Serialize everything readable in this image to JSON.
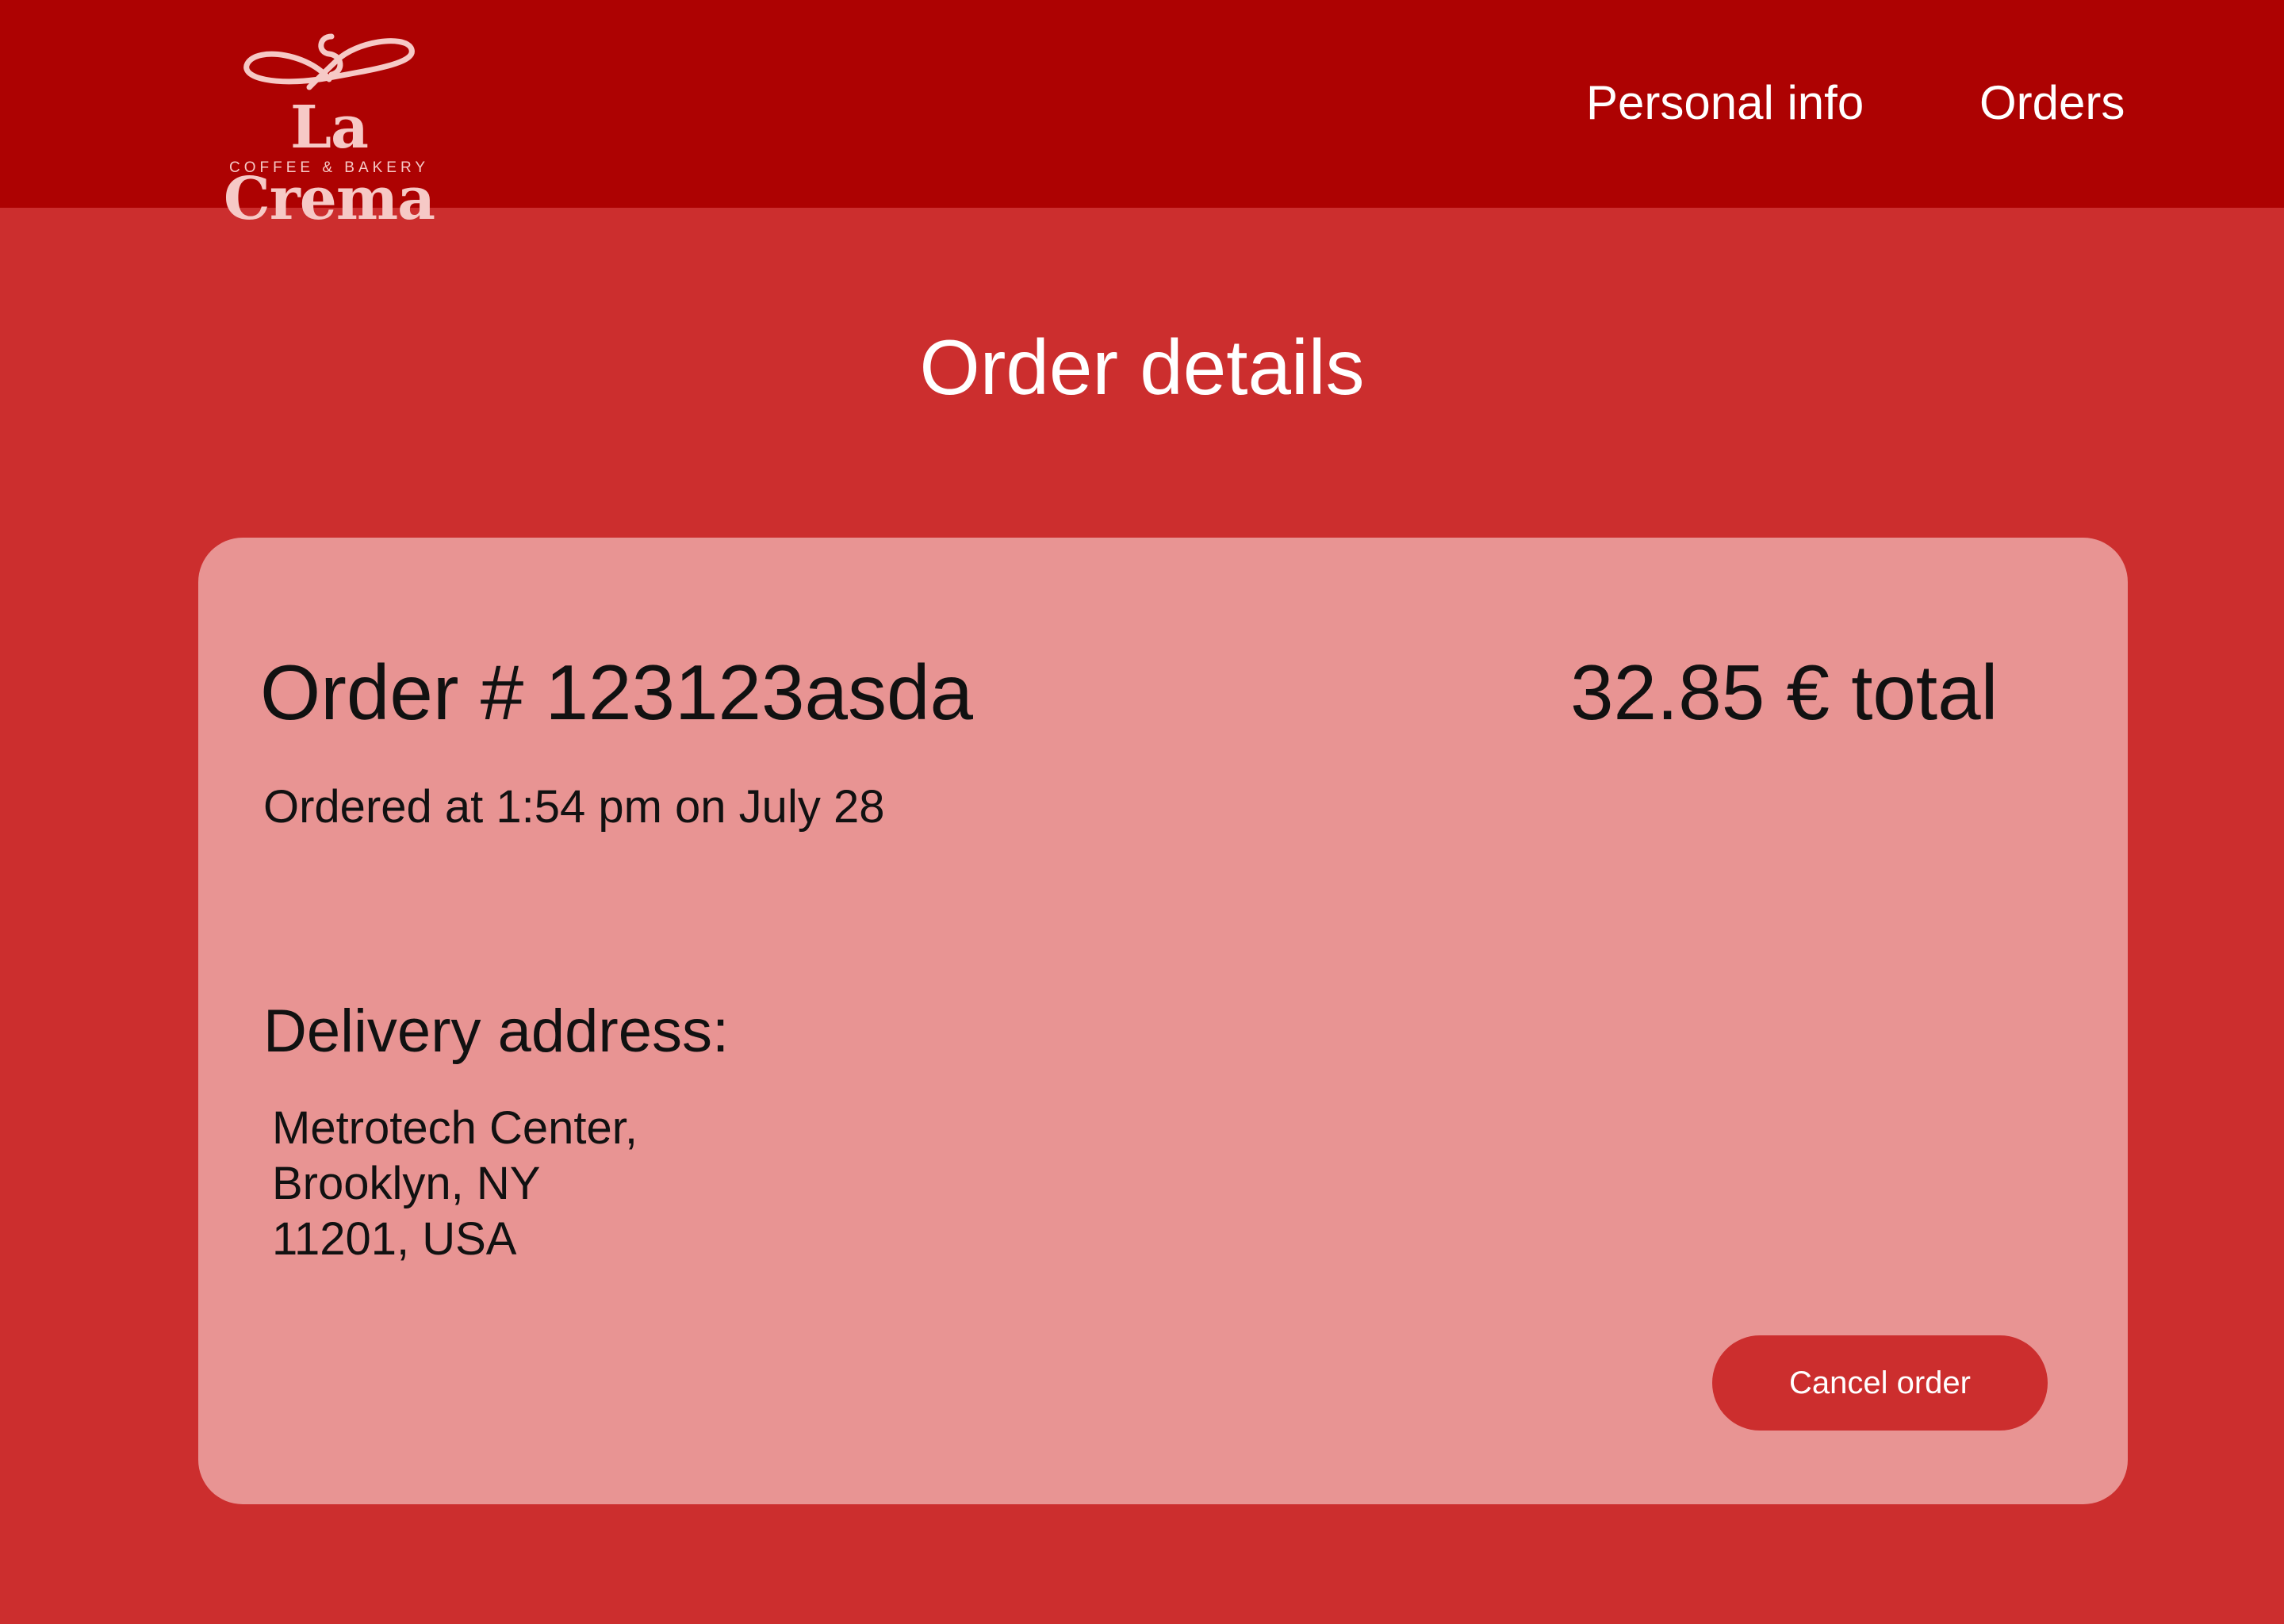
{
  "colors": {
    "header_background": "#ad0202",
    "page_background": "#cc2e2e",
    "card_background": "#e89493",
    "button_background": "#cc2e2e",
    "logo_color": "#f6c9c6"
  },
  "header": {
    "logo": {
      "name": "La Crema",
      "tagline": "COFFEE & BAKERY"
    },
    "nav": [
      {
        "label": "Personal info"
      },
      {
        "label": "Orders"
      }
    ]
  },
  "main": {
    "title": "Order details",
    "order": {
      "number_label": "Order # 123123asda",
      "total_label": "32.85 € total",
      "ordered_at": "Ordered at 1:54 pm on July 28",
      "delivery_heading": "Delivery address:",
      "address_lines": [
        "Metrotech Center,",
        "Brooklyn, NY",
        "11201, USA"
      ],
      "cancel_label": "Cancel order"
    }
  }
}
